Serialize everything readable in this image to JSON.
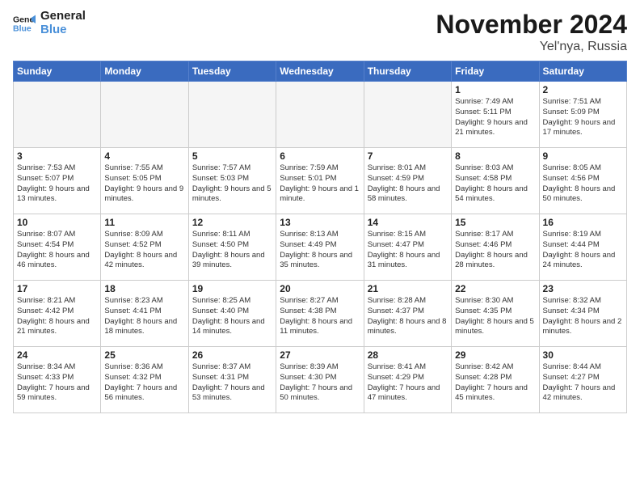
{
  "logo": {
    "line1": "General",
    "line2": "Blue"
  },
  "title": "November 2024",
  "subtitle": "Yel'nya, Russia",
  "weekdays": [
    "Sunday",
    "Monday",
    "Tuesday",
    "Wednesday",
    "Thursday",
    "Friday",
    "Saturday"
  ],
  "weeks": [
    [
      {
        "day": "",
        "info": ""
      },
      {
        "day": "",
        "info": ""
      },
      {
        "day": "",
        "info": ""
      },
      {
        "day": "",
        "info": ""
      },
      {
        "day": "",
        "info": ""
      },
      {
        "day": "1",
        "info": "Sunrise: 7:49 AM\nSunset: 5:11 PM\nDaylight: 9 hours\nand 21 minutes."
      },
      {
        "day": "2",
        "info": "Sunrise: 7:51 AM\nSunset: 5:09 PM\nDaylight: 9 hours\nand 17 minutes."
      }
    ],
    [
      {
        "day": "3",
        "info": "Sunrise: 7:53 AM\nSunset: 5:07 PM\nDaylight: 9 hours\nand 13 minutes."
      },
      {
        "day": "4",
        "info": "Sunrise: 7:55 AM\nSunset: 5:05 PM\nDaylight: 9 hours\nand 9 minutes."
      },
      {
        "day": "5",
        "info": "Sunrise: 7:57 AM\nSunset: 5:03 PM\nDaylight: 9 hours\nand 5 minutes."
      },
      {
        "day": "6",
        "info": "Sunrise: 7:59 AM\nSunset: 5:01 PM\nDaylight: 9 hours\nand 1 minute."
      },
      {
        "day": "7",
        "info": "Sunrise: 8:01 AM\nSunset: 4:59 PM\nDaylight: 8 hours\nand 58 minutes."
      },
      {
        "day": "8",
        "info": "Sunrise: 8:03 AM\nSunset: 4:58 PM\nDaylight: 8 hours\nand 54 minutes."
      },
      {
        "day": "9",
        "info": "Sunrise: 8:05 AM\nSunset: 4:56 PM\nDaylight: 8 hours\nand 50 minutes."
      }
    ],
    [
      {
        "day": "10",
        "info": "Sunrise: 8:07 AM\nSunset: 4:54 PM\nDaylight: 8 hours\nand 46 minutes."
      },
      {
        "day": "11",
        "info": "Sunrise: 8:09 AM\nSunset: 4:52 PM\nDaylight: 8 hours\nand 42 minutes."
      },
      {
        "day": "12",
        "info": "Sunrise: 8:11 AM\nSunset: 4:50 PM\nDaylight: 8 hours\nand 39 minutes."
      },
      {
        "day": "13",
        "info": "Sunrise: 8:13 AM\nSunset: 4:49 PM\nDaylight: 8 hours\nand 35 minutes."
      },
      {
        "day": "14",
        "info": "Sunrise: 8:15 AM\nSunset: 4:47 PM\nDaylight: 8 hours\nand 31 minutes."
      },
      {
        "day": "15",
        "info": "Sunrise: 8:17 AM\nSunset: 4:46 PM\nDaylight: 8 hours\nand 28 minutes."
      },
      {
        "day": "16",
        "info": "Sunrise: 8:19 AM\nSunset: 4:44 PM\nDaylight: 8 hours\nand 24 minutes."
      }
    ],
    [
      {
        "day": "17",
        "info": "Sunrise: 8:21 AM\nSunset: 4:42 PM\nDaylight: 8 hours\nand 21 minutes."
      },
      {
        "day": "18",
        "info": "Sunrise: 8:23 AM\nSunset: 4:41 PM\nDaylight: 8 hours\nand 18 minutes."
      },
      {
        "day": "19",
        "info": "Sunrise: 8:25 AM\nSunset: 4:40 PM\nDaylight: 8 hours\nand 14 minutes."
      },
      {
        "day": "20",
        "info": "Sunrise: 8:27 AM\nSunset: 4:38 PM\nDaylight: 8 hours\nand 11 minutes."
      },
      {
        "day": "21",
        "info": "Sunrise: 8:28 AM\nSunset: 4:37 PM\nDaylight: 8 hours\nand 8 minutes."
      },
      {
        "day": "22",
        "info": "Sunrise: 8:30 AM\nSunset: 4:35 PM\nDaylight: 8 hours\nand 5 minutes."
      },
      {
        "day": "23",
        "info": "Sunrise: 8:32 AM\nSunset: 4:34 PM\nDaylight: 8 hours\nand 2 minutes."
      }
    ],
    [
      {
        "day": "24",
        "info": "Sunrise: 8:34 AM\nSunset: 4:33 PM\nDaylight: 7 hours\nand 59 minutes."
      },
      {
        "day": "25",
        "info": "Sunrise: 8:36 AM\nSunset: 4:32 PM\nDaylight: 7 hours\nand 56 minutes."
      },
      {
        "day": "26",
        "info": "Sunrise: 8:37 AM\nSunset: 4:31 PM\nDaylight: 7 hours\nand 53 minutes."
      },
      {
        "day": "27",
        "info": "Sunrise: 8:39 AM\nSunset: 4:30 PM\nDaylight: 7 hours\nand 50 minutes."
      },
      {
        "day": "28",
        "info": "Sunrise: 8:41 AM\nSunset: 4:29 PM\nDaylight: 7 hours\nand 47 minutes."
      },
      {
        "day": "29",
        "info": "Sunrise: 8:42 AM\nSunset: 4:28 PM\nDaylight: 7 hours\nand 45 minutes."
      },
      {
        "day": "30",
        "info": "Sunrise: 8:44 AM\nSunset: 4:27 PM\nDaylight: 7 hours\nand 42 minutes."
      }
    ]
  ]
}
